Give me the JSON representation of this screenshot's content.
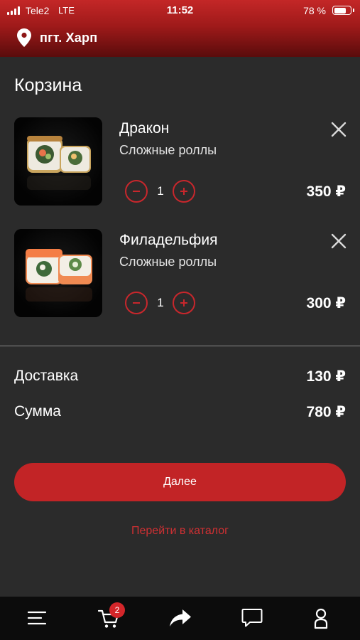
{
  "status_bar": {
    "carrier": "Tele2",
    "network": "LTE",
    "time": "11:52",
    "battery": "78 %",
    "battery_level": 0.78
  },
  "location": {
    "icon": "map-pin-icon",
    "city": "пгт. Харп"
  },
  "page_title": "Корзина",
  "cart": {
    "items": [
      {
        "name": "Дракон",
        "category": "Сложные роллы",
        "quantity": "1",
        "price": "350 ₽",
        "image": "dragon-roll-image"
      },
      {
        "name": "Филадельфия",
        "category": "Сложные роллы",
        "quantity": "1",
        "price": "300 ₽",
        "image": "philadelphia-roll-image"
      }
    ]
  },
  "summary": {
    "delivery_label": "Доставка",
    "delivery_value": "130 ₽",
    "total_label": "Сумма",
    "total_value": "780 ₽"
  },
  "actions": {
    "next_label": "Далее",
    "catalog_link": "Перейти в каталог"
  },
  "tabbar": {
    "tabs": [
      {
        "icon": "menu-icon"
      },
      {
        "icon": "cart-icon",
        "badge": "2"
      },
      {
        "icon": "share-arrow-icon"
      },
      {
        "icon": "chat-icon"
      },
      {
        "icon": "profile-icon"
      }
    ]
  },
  "colors": {
    "accent": "#c22426",
    "background": "#2b2b2b",
    "tabbar": "#0c0c0c"
  }
}
